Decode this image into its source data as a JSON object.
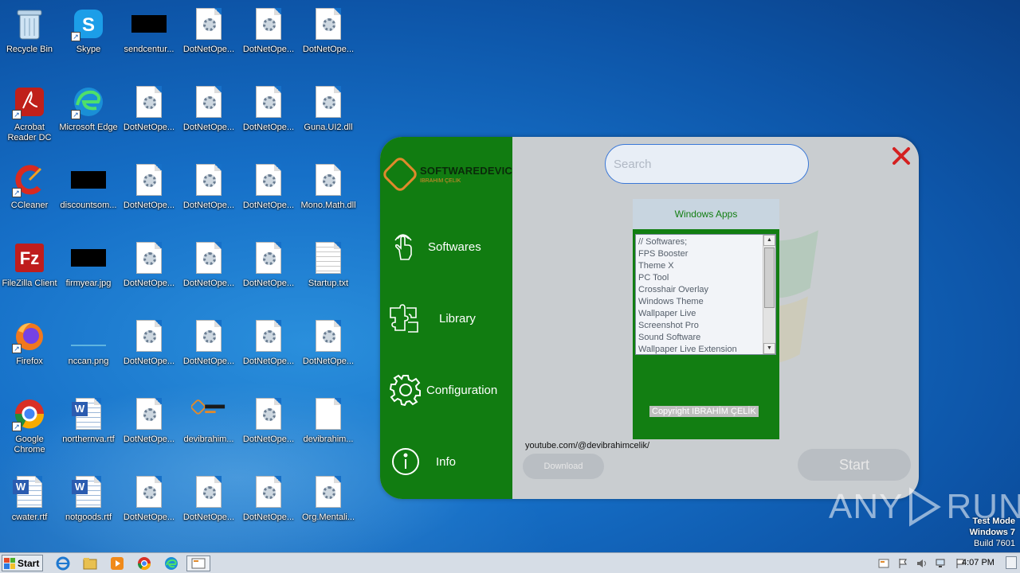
{
  "desktop": {
    "icons": [
      {
        "label": "Recycle Bin"
      },
      {
        "label": "Skype"
      },
      {
        "label": "sendcentur..."
      },
      {
        "label": "DotNetOpe..."
      },
      {
        "label": "DotNetOpe..."
      },
      {
        "label": "DotNetOpe..."
      },
      {
        "label": "Acrobat Reader DC"
      },
      {
        "label": "Microsoft Edge"
      },
      {
        "label": "DotNetOpe..."
      },
      {
        "label": "DotNetOpe..."
      },
      {
        "label": "DotNetOpe..."
      },
      {
        "label": "Guna.UI2.dll"
      },
      {
        "label": "CCleaner"
      },
      {
        "label": "discountsom..."
      },
      {
        "label": "DotNetOpe..."
      },
      {
        "label": "DotNetOpe..."
      },
      {
        "label": "DotNetOpe..."
      },
      {
        "label": "Mono.Math.dll"
      },
      {
        "label": "FileZilla Client"
      },
      {
        "label": "firmyear.jpg"
      },
      {
        "label": "DotNetOpe..."
      },
      {
        "label": "DotNetOpe..."
      },
      {
        "label": "DotNetOpe..."
      },
      {
        "label": "Startup.txt"
      },
      {
        "label": "Firefox"
      },
      {
        "label": "nccan.png"
      },
      {
        "label": "DotNetOpe..."
      },
      {
        "label": "DotNetOpe..."
      },
      {
        "label": "DotNetOpe..."
      },
      {
        "label": "DotNetOpe..."
      },
      {
        "label": "Google Chrome"
      },
      {
        "label": "northernva.rtf"
      },
      {
        "label": "DotNetOpe..."
      },
      {
        "label": "devibrahim..."
      },
      {
        "label": "DotNetOpe..."
      },
      {
        "label": "devibrahim..."
      },
      {
        "label": "cwater.rtf"
      },
      {
        "label": "notgoods.rtf"
      },
      {
        "label": "DotNetOpe..."
      },
      {
        "label": "DotNetOpe..."
      },
      {
        "label": "DotNetOpe..."
      },
      {
        "label": "Org.Mentali..."
      }
    ]
  },
  "app": {
    "logo_title": "SOFTWAREDEVIC",
    "logo_subtitle": "IBRAHIM ÇELIK",
    "nav": {
      "softwares": "Softwares",
      "library": "Library",
      "configuration": "Configuration",
      "info": "Info"
    },
    "search_placeholder": "Search",
    "panel_title": "Windows Apps",
    "list_items": [
      "// Softwares;",
      "FPS Booster",
      "Theme X",
      "PC Tool",
      "Crosshair Overlay",
      "Windows Theme",
      "Wallpaper Live",
      "Screenshot Pro",
      "Sound Software",
      "Wallpaper Live Extension"
    ],
    "copyright": "Copyright IBRAHİM ÇELİK",
    "youtube": "youtube.com/@devibrahimcelik/",
    "download_label": "Download",
    "start_label": "Start",
    "accent_green": "#117c11",
    "close_color": "#d42020"
  },
  "watermark": {
    "left": "ANY",
    "right": "RUN"
  },
  "os": {
    "test_mode": "Test Mode",
    "os_name": "Windows 7",
    "build": "Build 7601"
  },
  "taskbar": {
    "start_label": "Start",
    "clock": "4:07 PM"
  }
}
